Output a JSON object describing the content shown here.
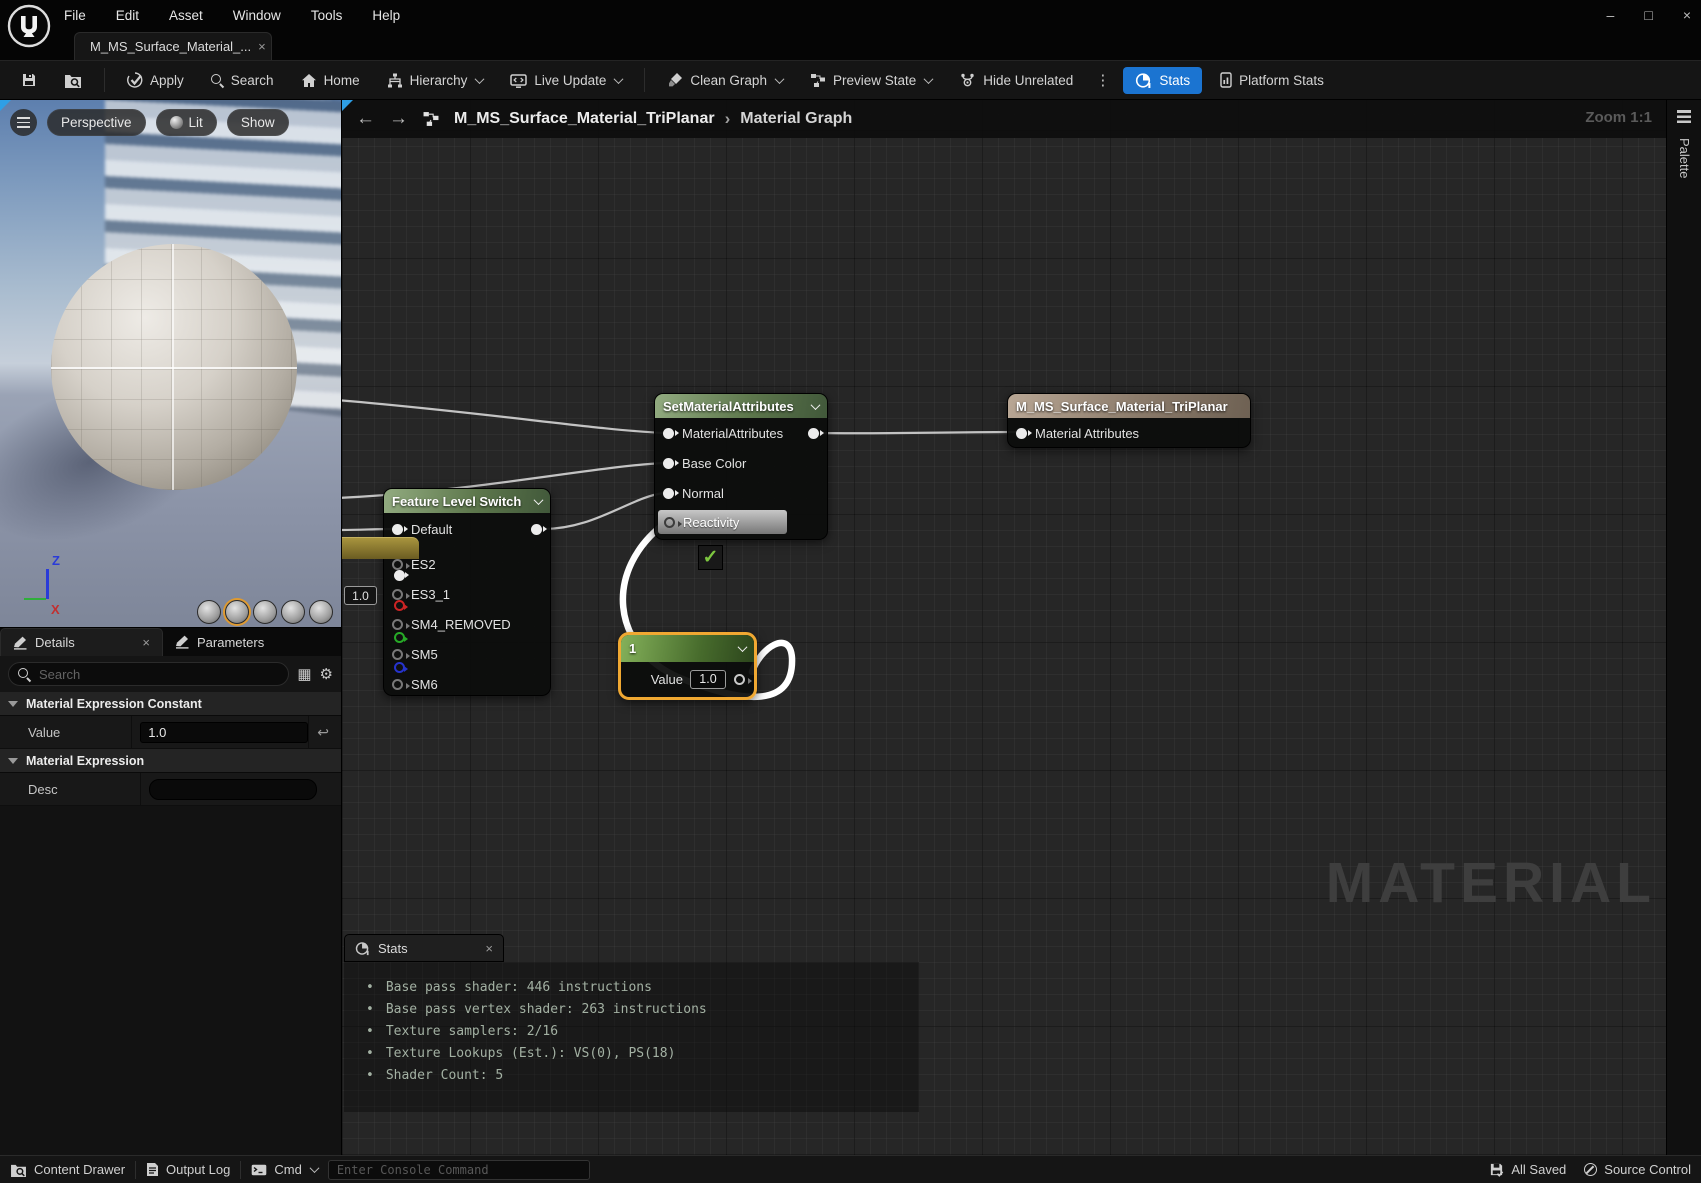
{
  "titlebar": {
    "menus": [
      "File",
      "Edit",
      "Asset",
      "Window",
      "Tools",
      "Help"
    ],
    "controls": {
      "minimize": "–",
      "maximize": "□",
      "close": "×"
    }
  },
  "tabbar": {
    "active_tab": "M_MS_Surface_Material_...",
    "close": "×"
  },
  "toolbar": {
    "apply": "Apply",
    "search": "Search",
    "home": "Home",
    "hierarchy": "Hierarchy",
    "live_update": "Live Update",
    "clean_graph": "Clean Graph",
    "preview_state": "Preview State",
    "hide_unrelated": "Hide Unrelated",
    "menu_dots": "⋮",
    "stats": "Stats",
    "platform_stats": "Platform Stats"
  },
  "viewport": {
    "perspective": "Perspective",
    "lit": "Lit",
    "show": "Show",
    "axis": {
      "x": "X",
      "z": "Z"
    }
  },
  "details": {
    "tab_details": "Details",
    "tab_parameters": "Parameters",
    "close": "×",
    "search_placeholder": "Search",
    "icons": {
      "grid": "▦",
      "gear": "⚙",
      "undo": "↩"
    },
    "section_constant": "Material Expression Constant",
    "value_label": "Value",
    "value": "1.0",
    "section_expression": "Material Expression",
    "desc_label": "Desc",
    "desc_value": ""
  },
  "graph": {
    "back": "←",
    "forward": "→",
    "breadcrumb_root": "M_MS_Surface_Material_TriPlanar",
    "breadcrumb_sep": "›",
    "breadcrumb_page": "Material Graph",
    "zoom_label": "Zoom 1:1",
    "palette": "Palette",
    "watermark": "MATERIAL",
    "float_value": "1.0",
    "check": "✓",
    "nodes": {
      "smattr": {
        "title": "SetMaterialAttributes",
        "pins": [
          "MaterialAttributes",
          "Base Color",
          "Normal",
          "Reactivity"
        ]
      },
      "result": {
        "title": "M_MS_Surface_Material_TriPlanar",
        "pins": [
          "Material Attributes"
        ]
      },
      "fls": {
        "title": "Feature Level Switch",
        "pins": [
          "Default",
          "ES2",
          "ES3_1",
          "SM4_REMOVED",
          "SM5",
          "SM6"
        ]
      },
      "constant": {
        "title": "1",
        "value_label": "Value",
        "value": "1.0"
      }
    }
  },
  "stats_panel": {
    "title": "Stats",
    "close": "×",
    "bullet": "•",
    "lines": [
      "Base pass shader: 446 instructions",
      "Base pass vertex shader: 263 instructions",
      "Texture samplers: 2/16",
      "Texture Lookups (Est.): VS(0), PS(18)",
      "Shader Count: 5"
    ]
  },
  "statusbar": {
    "content_drawer": "Content Drawer",
    "output_log": "Output Log",
    "cmd": "Cmd",
    "console_placeholder": "Enter Console Command",
    "all_saved": "All Saved",
    "source_control": "Source Control"
  },
  "colors": {
    "accent_blue": "#1b74d1",
    "selection_orange": "#f0a832",
    "node_green_header": "#5d774c",
    "node_tan_header": "#8a7a6a",
    "stats_text": "#a3b1a3",
    "check_green": "#7cc63f"
  }
}
